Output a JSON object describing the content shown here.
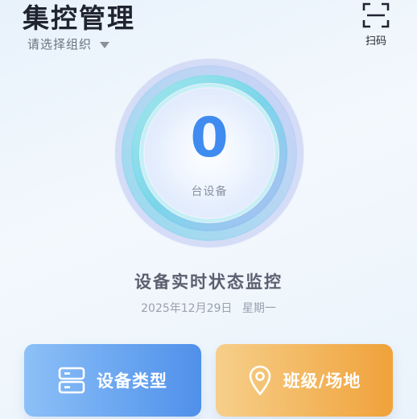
{
  "header": {
    "title": "集控管理",
    "org_select_label": "请选择组织",
    "scan_label": "扫码"
  },
  "device_summary": {
    "count": "0",
    "unit": "台设备"
  },
  "monitor": {
    "title": "设备实时状态监控",
    "date": "2025年12月29日",
    "weekday": "星期一"
  },
  "cards": {
    "device_types": {
      "label": "设备类型",
      "icon": "server-icon"
    },
    "class_place": {
      "label": "班级/场地",
      "icon": "location-pin-icon"
    }
  },
  "colors": {
    "count_blue": "#3f8bf0",
    "types_card": "#5a98ec",
    "places_card": "#f0a23a"
  }
}
